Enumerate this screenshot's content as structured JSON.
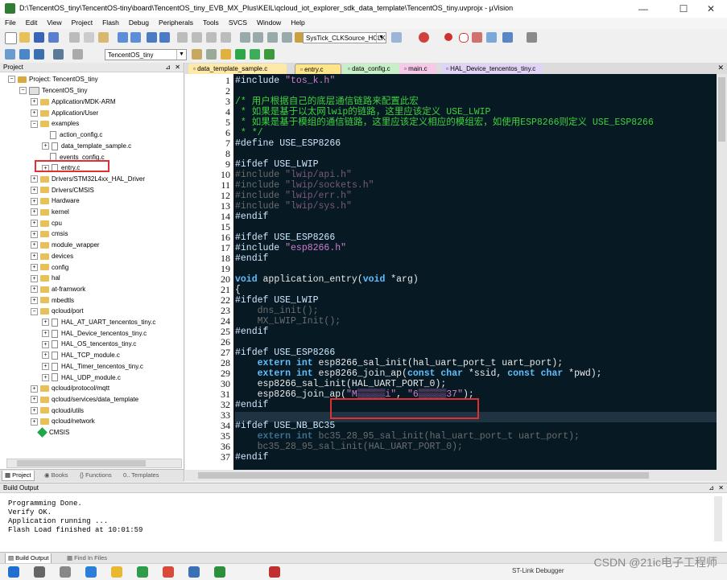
{
  "window": {
    "title": "D:\\TencentOS_tiny\\TencentOS-tiny\\board\\TencentOS_tiny_EVB_MX_Plus\\KEIL\\qcloud_iot_explorer_sdk_data_template\\TencentOS_tiny.uvprojx - µVision",
    "minimize": "—",
    "maximize": "☐",
    "close": "✕"
  },
  "menu": [
    "File",
    "Edit",
    "View",
    "Project",
    "Flash",
    "Debug",
    "Peripherals",
    "Tools",
    "SVCS",
    "Window",
    "Help"
  ],
  "toolbar": {
    "config_combo": "SysTick_CLKSource_HCLK",
    "target_combo": "TencentOS_tiny"
  },
  "project_panel": {
    "title": "Project",
    "root": "Project: TencentOS_tiny",
    "target": "TencentOS_tiny",
    "items": [
      {
        "label": "Application/MDK-ARM",
        "type": "folder"
      },
      {
        "label": "Application/User",
        "type": "folder"
      },
      {
        "label": "examples",
        "type": "folder-open"
      },
      {
        "label": "action_config.c",
        "type": "file"
      },
      {
        "label": "data_template_sample.c",
        "type": "file-exp"
      },
      {
        "label": "events_config.c",
        "type": "file"
      },
      {
        "label": "entry.c",
        "type": "file-exp"
      },
      {
        "label": "Drivers/STM32L4xx_HAL_Driver",
        "type": "folder"
      },
      {
        "label": "Drivers/CMSIS",
        "type": "folder"
      },
      {
        "label": "Hardware",
        "type": "folder"
      },
      {
        "label": "kernel",
        "type": "folder"
      },
      {
        "label": "cpu",
        "type": "folder"
      },
      {
        "label": "cmsis",
        "type": "folder"
      },
      {
        "label": "module_wrapper",
        "type": "folder"
      },
      {
        "label": "devices",
        "type": "folder"
      },
      {
        "label": "config",
        "type": "folder"
      },
      {
        "label": "hal",
        "type": "folder"
      },
      {
        "label": "at-framwork",
        "type": "folder"
      },
      {
        "label": "mbedtls",
        "type": "folder"
      },
      {
        "label": "qcloud/port",
        "type": "folder-open"
      },
      {
        "label": "HAL_AT_UART_tencentos_tiny.c",
        "type": "file-exp"
      },
      {
        "label": "HAL_Device_tencentos_tiny.c",
        "type": "file-exp"
      },
      {
        "label": "HAL_OS_tencentos_tiny.c",
        "type": "file-exp"
      },
      {
        "label": "HAL_TCP_module.c",
        "type": "file-exp"
      },
      {
        "label": "HAL_Timer_tencentos_tiny.c",
        "type": "file-exp"
      },
      {
        "label": "HAL_UDP_module.c",
        "type": "file-exp"
      },
      {
        "label": "qcloud/protocol/mqtt",
        "type": "folder"
      },
      {
        "label": "qcloud/services/data_template",
        "type": "folder"
      },
      {
        "label": "qcloud/utils",
        "type": "folder"
      },
      {
        "label": "qcloud/network",
        "type": "folder"
      },
      {
        "label": "CMSIS",
        "type": "component"
      }
    ],
    "tabs": [
      "Project",
      "Books",
      "Functions",
      "Templates"
    ]
  },
  "editor": {
    "tabs": [
      {
        "label": "data_template_sample.c",
        "color": "#ffe9a8"
      },
      {
        "label": "entry.c",
        "color": "#ffe58a"
      },
      {
        "label": "data_config.c",
        "color": "#c8f0c8"
      },
      {
        "label": "main.c",
        "color": "#f6c9e8"
      },
      {
        "label": "HAL_Device_tencentos_tiny.c",
        "color": "#e0d4f6"
      }
    ],
    "line_numbers": [
      "1",
      "2",
      "3",
      "4",
      "5",
      "6",
      "7",
      "8",
      "9",
      "10",
      "11",
      "12",
      "13",
      "14",
      "15",
      "16",
      "17",
      "18",
      "19",
      "20",
      "21",
      "22",
      "23",
      "24",
      "25",
      "26",
      "27",
      "28",
      "29",
      "30",
      "31",
      "32",
      "33",
      "34",
      "35",
      "36",
      "37"
    ],
    "code": {
      "l1a": "#include ",
      "l1b": "\"tos_k.h\"",
      "l3": "/* 用户根据自己的底层通信链路来配置此宏",
      "l4": " * 如果是基于以太网lwip的链路，这里应该定义 USE_LWIP",
      "l5": " * 如果是基于模组的通信链路，这里应该定义相应的模组宏，如使用ESP8266则定义 USE_ESP8266",
      "l6": " * */",
      "l7": "#define USE_ESP8266",
      "l9": "#ifdef USE_LWIP",
      "l10a": "#include ",
      "l10b": "\"lwip/api.h\"",
      "l11a": "#include ",
      "l11b": "\"lwip/sockets.h\"",
      "l12a": "#include ",
      "l12b": "\"lwip/err.h\"",
      "l13a": "#include ",
      "l13b": "\"lwip/sys.h\"",
      "l14": "#endif",
      "l16": "#ifdef USE_ESP8266",
      "l17a": "#include ",
      "l17b": "\"esp8266.h\"",
      "l18": "#endif",
      "l20a": "void",
      "l20b": " application_entry(",
      "l20c": "void",
      "l20d": " *arg)",
      "l21": "{",
      "l22": "#ifdef USE_LWIP",
      "l23": "    dns_init();",
      "l24": "    MX_LWIP_Init();",
      "l25": "#endif",
      "l27": "#ifdef USE_ESP8266",
      "l28a": "    ",
      "l28b": "extern",
      "l28c": " ",
      "l28d": "int",
      "l28e": " esp8266_sal_init(hal_uart_port_t uart_port);",
      "l29a": "    ",
      "l29b": "extern",
      "l29c": " ",
      "l29d": "int",
      "l29e": " esp8266_join_ap(",
      "l29f": "const",
      "l29g": " ",
      "l29h": "char",
      "l29i": " *ssid, ",
      "l29j": "const",
      "l29k": " ",
      "l29l": "char",
      "l29m": " *pwd);",
      "l30": "    esp8266_sal_init(HAL_UART_PORT_0);",
      "l31a": "    esp8266_join_ap(",
      "l31b": "\"M▒▒▒▒▒i\"",
      "l31c": ", ",
      "l31d": "\"6▒▒▒▒▒37\"",
      "l31e": ");",
      "l32": "#endif",
      "l34": "#ifdef USE_NB_BC35",
      "l35a": "    ",
      "l35b": "extern",
      "l35c": " ",
      "l35d": "int",
      "l35e": " bc35_28_95_sal_init(hal_uart_port_t uart_port);",
      "l36": "    bc35_28_95_sal_init(HAL_UART_PORT_0);",
      "l37": "#endif"
    }
  },
  "build_output": {
    "title": "Build Output",
    "lines": "Programming Done.\nVerify OK.\nApplication running ...\nFlash Load finished at 10:01:59",
    "tabs": [
      "Build Output",
      "Find In Files"
    ]
  },
  "status": {
    "debugger": "ST-Link Debugger"
  },
  "watermark": "CSDN @21ic电子工程师"
}
